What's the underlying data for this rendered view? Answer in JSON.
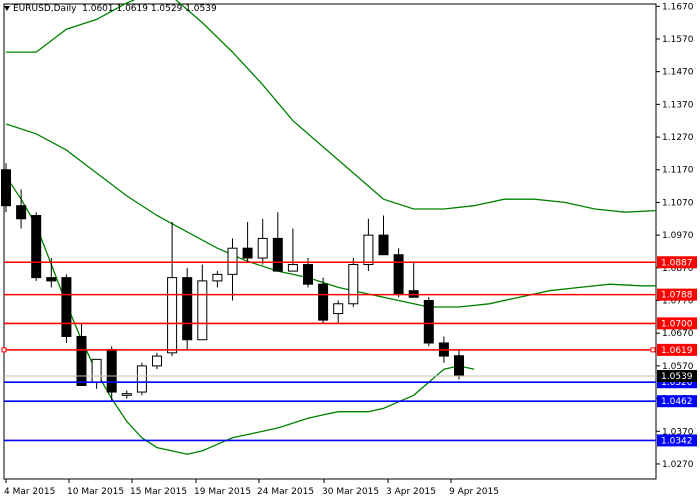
{
  "header": {
    "symbol_title": "EURUSD,Daily",
    "ohlc": "1.0601 1.0619 1.0529 1.0539",
    "menu_icon": "triangle-down-icon"
  },
  "colors": {
    "candle_outline": "#000000",
    "bull_fill": "#ffffff",
    "bear_fill": "#000000",
    "bands": "#008000",
    "resistance": "#ff0000",
    "support": "#0000ff",
    "support_label_bg": "#0000ff",
    "resistance_label_bg": "#ff0000",
    "price_label_bg": "#000000",
    "label_text": "#ffffff"
  },
  "chart_data": {
    "type": "candlestick",
    "ylim": [
      1.0224,
      1.1677
    ],
    "y_ticks": [
      "1.1670",
      "1.1570",
      "1.1470",
      "1.1370",
      "1.1270",
      "1.1170",
      "1.1070",
      "1.0970",
      "1.0870",
      "1.0770",
      "1.0670",
      "1.0570",
      "1.0470",
      "1.0370",
      "1.0270"
    ],
    "x_labels": [
      "4 Mar 2015",
      "10 Mar 2015",
      "15 Mar 2015",
      "19 Mar 2015",
      "24 Mar 2015",
      "30 Mar 2015",
      "3 Apr 2015",
      "9 Apr 2015"
    ],
    "candles": [
      {
        "o": 1.117,
        "h": 1.119,
        "l": 1.104,
        "c": 1.106
      },
      {
        "o": 1.106,
        "h": 1.111,
        "l": 1.099,
        "c": 1.102
      },
      {
        "o": 1.103,
        "h": 1.104,
        "l": 1.083,
        "c": 1.084
      },
      {
        "o": 1.084,
        "h": 1.09,
        "l": 1.081,
        "c": 1.083
      },
      {
        "o": 1.084,
        "h": 1.085,
        "l": 1.064,
        "c": 1.066
      },
      {
        "o": 1.066,
        "h": 1.07,
        "l": 1.051,
        "c": 1.051
      },
      {
        "o": 1.052,
        "h": 1.059,
        "l": 1.05,
        "c": 1.059
      },
      {
        "o": 1.062,
        "h": 1.063,
        "l": 1.046,
        "c": 1.049
      },
      {
        "o": 1.048,
        "h": 1.0495,
        "l": 1.047,
        "c": 1.0485
      },
      {
        "o": 1.049,
        "h": 1.058,
        "l": 1.048,
        "c": 1.057
      },
      {
        "o": 1.057,
        "h": 1.061,
        "l": 1.056,
        "c": 1.06
      },
      {
        "o": 1.061,
        "h": 1.101,
        "l": 1.06,
        "c": 1.084
      },
      {
        "o": 1.084,
        "h": 1.087,
        "l": 1.062,
        "c": 1.065
      },
      {
        "o": 1.065,
        "h": 1.088,
        "l": 1.065,
        "c": 1.083
      },
      {
        "o": 1.083,
        "h": 1.086,
        "l": 1.081,
        "c": 1.085
      },
      {
        "o": 1.085,
        "h": 1.096,
        "l": 1.077,
        "c": 1.093
      },
      {
        "o": 1.093,
        "h": 1.101,
        "l": 1.089,
        "c": 1.09
      },
      {
        "o": 1.09,
        "h": 1.102,
        "l": 1.088,
        "c": 1.096
      },
      {
        "o": 1.096,
        "h": 1.104,
        "l": 1.086,
        "c": 1.086
      },
      {
        "o": 1.086,
        "h": 1.099,
        "l": 1.086,
        "c": 1.088
      },
      {
        "o": 1.088,
        "h": 1.09,
        "l": 1.081,
        "c": 1.082
      },
      {
        "o": 1.082,
        "h": 1.084,
        "l": 1.07,
        "c": 1.071
      },
      {
        "o": 1.073,
        "h": 1.077,
        "l": 1.07,
        "c": 1.076
      },
      {
        "o": 1.076,
        "h": 1.09,
        "l": 1.075,
        "c": 1.088
      },
      {
        "o": 1.088,
        "h": 1.102,
        "l": 1.086,
        "c": 1.097
      },
      {
        "o": 1.097,
        "h": 1.103,
        "l": 1.091,
        "c": 1.091
      },
      {
        "o": 1.091,
        "h": 1.093,
        "l": 1.078,
        "c": 1.079
      },
      {
        "o": 1.08,
        "h": 1.089,
        "l": 1.078,
        "c": 1.078
      },
      {
        "o": 1.077,
        "h": 1.078,
        "l": 1.063,
        "c": 1.064
      },
      {
        "o": 1.064,
        "h": 1.066,
        "l": 1.058,
        "c": 1.06
      },
      {
        "o": 1.0601,
        "h": 1.0619,
        "l": 1.0529,
        "c": 1.0539
      }
    ],
    "band_upper": [
      [
        0,
        1.153
      ],
      [
        2,
        1.153
      ],
      [
        4,
        1.16
      ],
      [
        6,
        1.163
      ],
      [
        8,
        1.168
      ],
      [
        9,
        1.17
      ],
      [
        11,
        1.17
      ],
      [
        13,
        1.162
      ],
      [
        15,
        1.153
      ],
      [
        17,
        1.143
      ],
      [
        19,
        1.132
      ],
      [
        21,
        1.124
      ],
      [
        23,
        1.116
      ],
      [
        25,
        1.108
      ],
      [
        27,
        1.105
      ],
      [
        29,
        1.105
      ],
      [
        31,
        1.106
      ],
      [
        33,
        1.108
      ],
      [
        35,
        1.108
      ],
      [
        37,
        1.107
      ],
      [
        39,
        1.105
      ],
      [
        41,
        1.104
      ],
      [
        43,
        1.1045
      ]
    ],
    "band_middle": [
      [
        0,
        1.131
      ],
      [
        2,
        1.128
      ],
      [
        4,
        1.123
      ],
      [
        6,
        1.116
      ],
      [
        8,
        1.109
      ],
      [
        10,
        1.103
      ],
      [
        12,
        1.098
      ],
      [
        14,
        1.093
      ],
      [
        16,
        1.089
      ],
      [
        18,
        1.086
      ],
      [
        20,
        1.084
      ],
      [
        22,
        1.081
      ],
      [
        24,
        1.079
      ],
      [
        26,
        1.077
      ],
      [
        28,
        1.075
      ],
      [
        30,
        1.075
      ],
      [
        32,
        1.076
      ],
      [
        34,
        1.078
      ],
      [
        36,
        1.08
      ],
      [
        38,
        1.081
      ],
      [
        40,
        1.082
      ],
      [
        42,
        1.0815
      ],
      [
        43,
        1.0815
      ]
    ],
    "band_lower": [
      [
        0,
        1.115
      ],
      [
        1,
        1.108
      ],
      [
        2,
        1.1
      ],
      [
        3,
        1.088
      ],
      [
        4,
        1.076
      ],
      [
        5,
        1.065
      ],
      [
        6,
        1.055
      ],
      [
        7,
        1.047
      ],
      [
        8,
        1.04
      ],
      [
        9,
        1.035
      ],
      [
        10,
        1.032
      ],
      [
        11,
        1.031
      ],
      [
        12,
        1.03
      ],
      [
        13,
        1.031
      ],
      [
        14,
        1.033
      ],
      [
        15,
        1.035
      ],
      [
        16,
        1.036
      ],
      [
        17,
        1.037
      ],
      [
        18,
        1.038
      ],
      [
        19,
        1.0395
      ],
      [
        20,
        1.041
      ],
      [
        21,
        1.042
      ],
      [
        22,
        1.043
      ],
      [
        24,
        1.043
      ],
      [
        25,
        1.044
      ],
      [
        26,
        1.046
      ],
      [
        27,
        1.048
      ],
      [
        28,
        1.052
      ],
      [
        29,
        1.056
      ],
      [
        30,
        1.057
      ],
      [
        31,
        1.056
      ]
    ],
    "resistance_levels": [
      1.0887,
      1.0788,
      1.07,
      1.0619
    ],
    "support_levels": [
      1.052,
      1.0462,
      1.0342
    ],
    "level_labels": {
      "resistance": [
        "1.0887",
        "1.0788",
        "1.0700",
        "1.0619"
      ],
      "support": [
        "1.0520",
        "1.0462",
        "1.0342"
      ]
    },
    "current_price": 1.0539,
    "current_price_label": "1.0539"
  }
}
